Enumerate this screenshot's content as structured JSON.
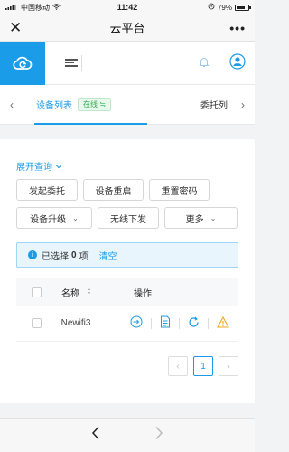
{
  "status_bar": {
    "carrier": "中国移动",
    "time": "11:42",
    "battery": "79%",
    "battery_level": 0.79
  },
  "nav": {
    "title": "云平台",
    "close_glyph": "✕",
    "more_glyph": "•••"
  },
  "tabs": {
    "active_label": "设备列表",
    "online_badge": "在线 ≒",
    "second_label": "委托列"
  },
  "query": {
    "expand_label": "展开查询"
  },
  "actions": {
    "initiate_delegation": "发起委托",
    "reboot_device": "设备重启",
    "reset_password": "重置密码",
    "upgrade_device": "设备升级",
    "wireless_push": "无线下发",
    "more": "更多"
  },
  "selection": {
    "prefix": "已选择",
    "count": "0",
    "suffix": "项",
    "clear_label": "清空",
    "info_glyph": "i"
  },
  "table": {
    "header_name": "名称",
    "header_ops": "操作",
    "rows": [
      {
        "name": "Newifi3"
      }
    ]
  },
  "pagination": {
    "current": "1",
    "prev_glyph": "‹",
    "next_glyph": "›"
  },
  "colors": {
    "accent": "#1b9ce8",
    "online": "#2ab04b",
    "warning": "#f5a623"
  }
}
